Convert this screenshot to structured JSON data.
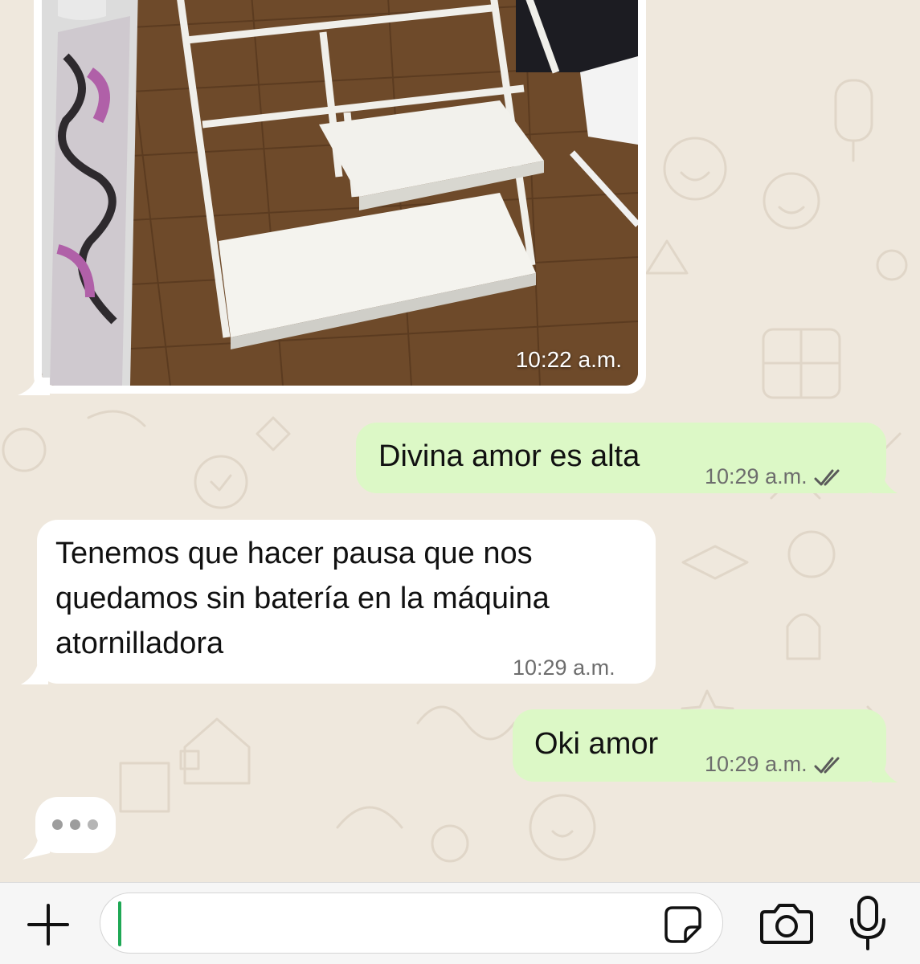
{
  "chat": {
    "messages": [
      {
        "direction": "incoming",
        "type": "image",
        "time": "10:22 a.m."
      },
      {
        "direction": "outgoing",
        "type": "text",
        "text": "Divina amor es alta",
        "time": "10:29 a.m.",
        "status": "read"
      },
      {
        "direction": "incoming",
        "type": "text",
        "lines": [
          "Tenemos que hacer pausa que nos",
          "quedamos sin batería en la máquina",
          "atornilladora"
        ],
        "time": "10:29 a.m."
      },
      {
        "direction": "outgoing",
        "type": "text",
        "text": "Oki amor",
        "time": "10:29 a.m.",
        "status": "read"
      }
    ],
    "typing_indicator": true
  },
  "composer": {
    "input_value": "",
    "icons": {
      "attach": "plus-icon",
      "sticker": "sticker-icon",
      "camera": "camera-icon",
      "mic": "microphone-icon"
    }
  },
  "colors": {
    "background": "#efe8dd",
    "outgoing_bubble": "#dcf8c6",
    "incoming_bubble": "#ffffff",
    "cursor": "#1fa855",
    "ticks": "#5a5a5a"
  }
}
